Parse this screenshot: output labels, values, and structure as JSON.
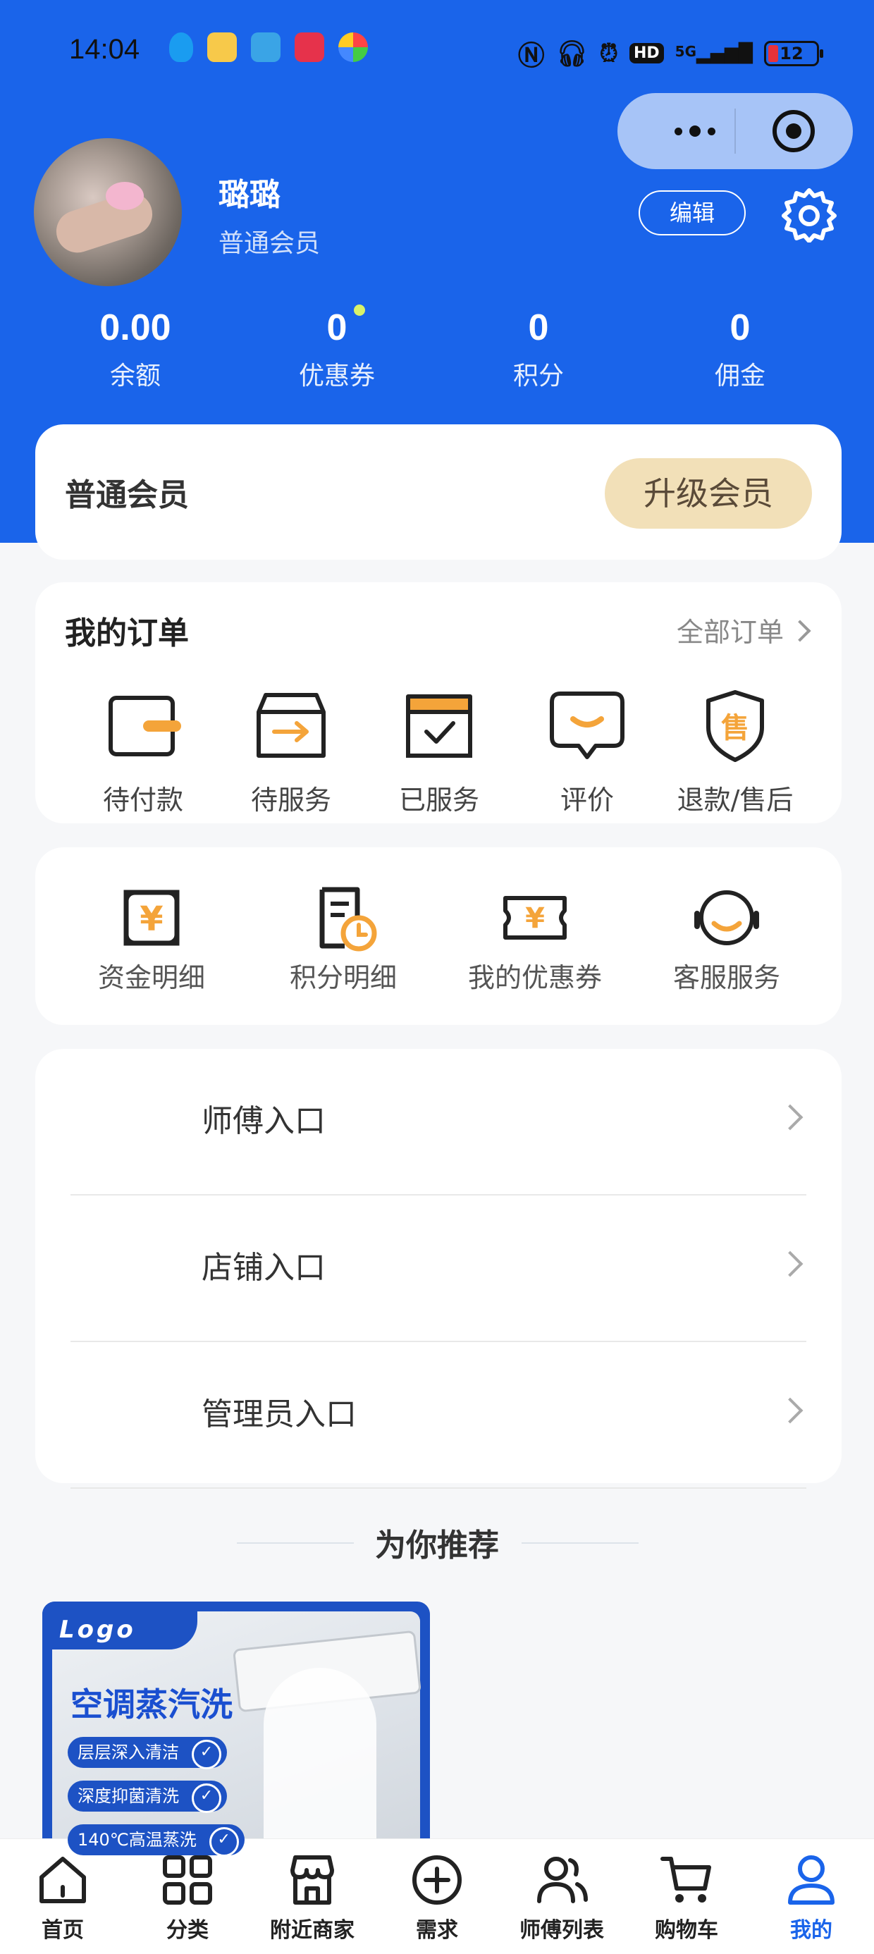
{
  "status_bar": {
    "time": "14:04",
    "network": "5G",
    "hd": "HD",
    "battery": "12",
    "app_icons": [
      "qq-icon",
      "weibo-icon",
      "telegram-icon",
      "app-icon-red",
      "app-icon-colorful"
    ]
  },
  "profile": {
    "username": "璐璐",
    "level": "普通会员",
    "edit_label": "编辑"
  },
  "stats": [
    {
      "value": "0.00",
      "label": "余额"
    },
    {
      "value": "0",
      "label": "优惠券"
    },
    {
      "value": "0",
      "label": "积分"
    },
    {
      "value": "0",
      "label": "佣金"
    }
  ],
  "member": {
    "title": "普通会员",
    "upgrade_label": "升级会员"
  },
  "orders": {
    "title": "我的订单",
    "all_label": "全部订单",
    "items": [
      {
        "label": "待付款",
        "icon": "wallet-icon"
      },
      {
        "label": "待服务",
        "icon": "box-arrow-icon"
      },
      {
        "label": "已服务",
        "icon": "box-check-icon"
      },
      {
        "label": "评价",
        "icon": "comment-smile-icon"
      },
      {
        "label": "退款/售后",
        "icon": "shield-sale-icon"
      }
    ],
    "sale_glyph": "售"
  },
  "tools": {
    "items": [
      {
        "label": "资金明细",
        "icon": "yuan-frame-icon"
      },
      {
        "label": "积分明细",
        "icon": "document-clock-icon"
      },
      {
        "label": "我的优惠券",
        "icon": "coupon-icon"
      },
      {
        "label": "客服服务",
        "icon": "headset-icon"
      }
    ],
    "yuan_glyph": "¥"
  },
  "entries": [
    {
      "label": "师傅入口"
    },
    {
      "label": "店铺入口"
    },
    {
      "label": "管理员入口"
    }
  ],
  "recommend": {
    "title": "为你推荐",
    "card": {
      "logo": "Logo",
      "headline": "空调蒸汽洗",
      "tags": [
        "层层深入清洁",
        "深度抑菌清洗",
        "140℃高温蒸洗"
      ]
    }
  },
  "tabbar": [
    {
      "label": "首页",
      "icon": "home-icon",
      "active": false
    },
    {
      "label": "分类",
      "icon": "grid-icon",
      "active": false
    },
    {
      "label": "附近商家",
      "icon": "store-icon",
      "active": false
    },
    {
      "label": "需求",
      "icon": "plus-circle-icon",
      "active": false
    },
    {
      "label": "师傅列表",
      "icon": "users-icon",
      "active": false
    },
    {
      "label": "购物车",
      "icon": "cart-icon",
      "active": false
    },
    {
      "label": "我的",
      "icon": "user-icon",
      "active": true
    }
  ],
  "colors": {
    "primary": "#1a64ea",
    "accent_orange": "#f4a43a",
    "upgrade_bg": "#f2e0b8"
  }
}
